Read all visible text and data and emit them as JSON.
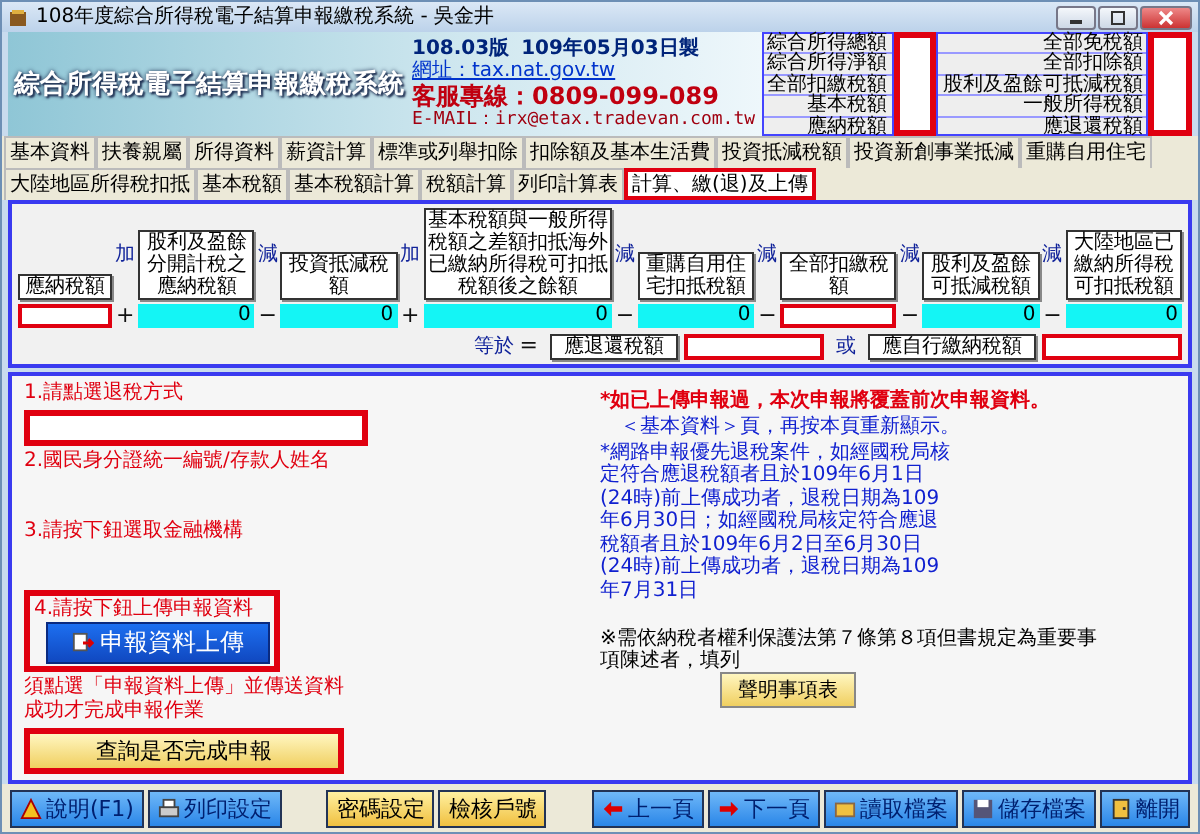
{
  "window": {
    "title": "108年度綜合所得稅電子結算申報繳稅系統 - 吳金井"
  },
  "banner": {
    "title": "綜合所得稅電子結算申報繳稅系統",
    "version": "108.03版",
    "date": "109年05月03日製",
    "website": "網址：tax.nat.gov.tw",
    "hotline": "客服專線：0809-099-089",
    "email": "E-MAIL：irx@etax.tradevan.com.tw"
  },
  "summary": [
    {
      "labels": [
        "綜合所得總額",
        "綜合所得淨額",
        "全部扣繳稅額",
        "基本稅額",
        "應納稅額"
      ],
      "highlighted": true
    },
    {
      "labels": [
        "全部免稅額",
        "全部扣除額",
        "股利及盈餘可抵減稅額",
        "一般所得稅額",
        "應退還稅額"
      ],
      "highlighted": true
    }
  ],
  "tab_rows": [
    [
      {
        "label": "基本資料",
        "selected": false,
        "highlighted": false
      },
      {
        "label": "扶養親屬",
        "selected": false,
        "highlighted": false
      },
      {
        "label": "所得資料",
        "selected": false,
        "highlighted": false
      },
      {
        "label": "薪資計算",
        "selected": false,
        "highlighted": false
      },
      {
        "label": "標準或列舉扣除",
        "selected": false,
        "highlighted": false
      },
      {
        "label": "扣除額及基本生活費",
        "selected": false,
        "highlighted": false
      },
      {
        "label": "投資抵減稅額",
        "selected": false,
        "highlighted": false
      },
      {
        "label": "投資新創事業抵減",
        "selected": false,
        "highlighted": false
      },
      {
        "label": "重購自用住宅",
        "selected": false,
        "highlighted": false
      }
    ],
    [
      {
        "label": "大陸地區所得稅扣抵",
        "selected": false,
        "highlighted": false
      },
      {
        "label": "基本稅額",
        "selected": false,
        "highlighted": false
      },
      {
        "label": "基本稅額計算",
        "selected": false,
        "highlighted": false
      },
      {
        "label": "稅額計算",
        "selected": false,
        "highlighted": false
      },
      {
        "label": "列印計算表",
        "selected": false,
        "highlighted": false
      },
      {
        "label": "計算、繳(退)及上傳",
        "selected": true,
        "highlighted": true
      }
    ]
  ],
  "formula": {
    "items": [
      {
        "label": "應納稅額",
        "highlighted": true
      },
      {
        "label": "股利及盈餘分開計稅之應納稅額",
        "value": "0",
        "highlighted": false
      },
      {
        "label": "投資抵減稅額",
        "value": "0",
        "highlighted": false
      },
      {
        "label": "基本稅額與一般所得稅額之差額扣抵海外已繳納所得稅可扣抵稅額後之餘額",
        "value": "0",
        "highlighted": false
      },
      {
        "label": "重購自用住宅扣抵稅額",
        "value": "0",
        "highlighted": false
      },
      {
        "label": "全部扣繳稅額",
        "highlighted": true
      },
      {
        "label": "股利及盈餘可抵減稅額",
        "value": "0",
        "highlighted": false
      },
      {
        "label": "大陸地區已繳納所得稅可扣抵稅額",
        "value": "0",
        "highlighted": false
      }
    ],
    "operators": [
      {
        "word": "加",
        "symbol": "+"
      },
      {
        "word": "減",
        "symbol": "−"
      },
      {
        "word": "加",
        "symbol": "+"
      },
      {
        "word": "減",
        "symbol": "−"
      },
      {
        "word": "減",
        "symbol": "−"
      },
      {
        "word": "減",
        "symbol": "−"
      },
      {
        "word": "減",
        "symbol": "−"
      }
    ],
    "equals_word": "等於",
    "equals_symbol": "=",
    "or_word": "或",
    "results": [
      {
        "label": "應退還稅額",
        "highlighted": true
      },
      {
        "label": "應自行繳納稅額",
        "highlighted": true
      }
    ]
  },
  "steps": {
    "refund_method": {
      "label": "1.請點選退稅方式",
      "highlighted": true
    },
    "account": {
      "label": "2.國民身分證統一編號/存款人姓名"
    },
    "bank": {
      "label": "3.請按下鈕選取金融機構"
    },
    "upload": {
      "label": "4.請按下鈕上傳申報資料",
      "button": "申報資料上傳",
      "highlighted": true
    },
    "upload_note": "須點選「申報資料上傳」並傳送資料成功才完成申報作業",
    "query": {
      "button": "查詢是否完成申報",
      "highlighted": true
    }
  },
  "notices": {
    "warning": "*如已上傳申報過，本次申報將覆蓋前次申報資料。",
    "redisplay": "＜基本資料＞頁，再按本頁重新顯示。",
    "refund_info": "*網路申報優先退稅案件，如經國稅局核定符合應退稅額者且於109年6月1日(24時)前上傳成功者，退稅日期為109年6月30日；如經國稅局核定符合應退稅額者且於109年6月2日至6月30日(24時)前上傳成功者，退稅日期為109年7月31日",
    "statement_note": "※需依納稅者權利保護法第７條第８項但書規定為重要事項陳述者，填列",
    "statement_button": "聲明事項表"
  },
  "toolbar": [
    [
      {
        "label": "說明(F1)",
        "kind": "icon"
      },
      {
        "label": "列印設定",
        "kind": "icon"
      }
    ],
    [
      {
        "label": "密碼設定",
        "kind": "plain"
      },
      {
        "label": "檢核戶號",
        "kind": "plain"
      }
    ],
    [
      {
        "label": "上一頁",
        "kind": "icon"
      },
      {
        "label": "下一頁",
        "kind": "icon"
      },
      {
        "label": "讀取檔案",
        "kind": "icon"
      },
      {
        "label": "儲存檔案",
        "kind": "icon"
      },
      {
        "label": "離開",
        "kind": "icon"
      }
    ]
  ]
}
